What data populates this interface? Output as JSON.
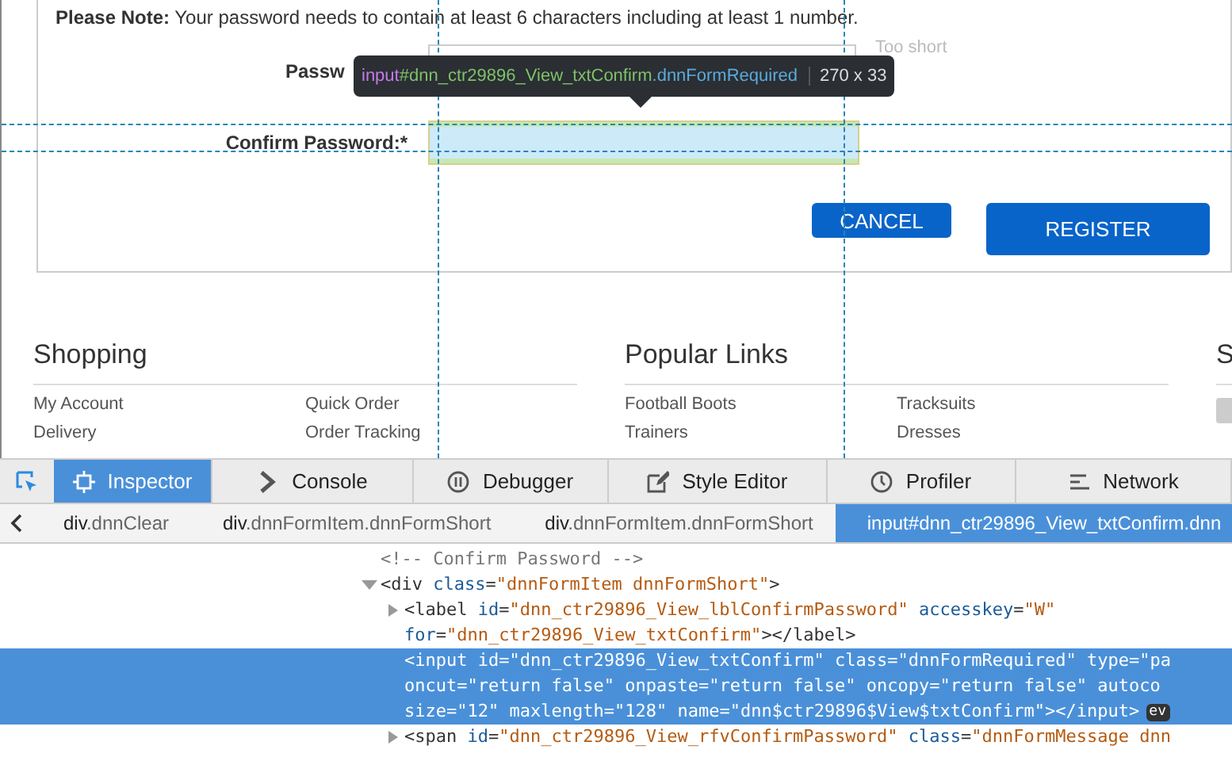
{
  "form": {
    "note_label": "Please Note:",
    "note_text": "Your password needs to contain at least 6 characters including at least 1 number.",
    "fields": [
      {
        "label": "Passw",
        "hint": "Too short",
        "highlighted": false
      },
      {
        "label": "Confirm Password:*",
        "highlighted": true
      }
    ],
    "buttons": [
      {
        "label": "CANCEL",
        "kind": "secondary"
      },
      {
        "label": "REGISTER",
        "kind": "primary"
      }
    ]
  },
  "tooltip": {
    "tag": "input",
    "id": "#dnn_ctr29896_View_txtConfirm",
    "class": ".dnnFormRequired",
    "size": "270 x 33"
  },
  "footer": [
    {
      "title": "Shopping",
      "links": [
        [
          "My Account",
          "Quick Order"
        ],
        [
          "Delivery",
          "Order Tracking"
        ]
      ]
    },
    {
      "title": "Popular Links",
      "links": [
        [
          "Football Boots",
          "Tracksuits"
        ],
        [
          "Trainers",
          "Dresses"
        ]
      ]
    },
    {
      "title": "S"
    }
  ],
  "devtools": {
    "tabs": [
      {
        "label": "Inspector",
        "selected": true
      },
      {
        "label": "Console",
        "selected": false
      },
      {
        "label": "Debugger",
        "selected": false
      },
      {
        "label": "Style Editor",
        "selected": false
      },
      {
        "label": "Profiler",
        "selected": false
      },
      {
        "label": "Network",
        "selected": false
      }
    ],
    "breadcrumbs": [
      {
        "tag": "div",
        "cls": ".dnnClear",
        "selected": false
      },
      {
        "tag": "div",
        "cls": ".dnnFormItem.dnnFormShort",
        "selected": false
      },
      {
        "tag": "div",
        "cls": ".dnnFormItem.dnnFormShort",
        "selected": false
      },
      {
        "tag": "input",
        "cls": "#dnn_ctr29896_View_txtConfirm.dnn",
        "selected": true
      }
    ],
    "tree": [
      {
        "kind": "comment",
        "selected": false,
        "lines": [
          "<!-- Confirm Password -->"
        ]
      },
      {
        "kind": "element",
        "expanded": true,
        "selected": false,
        "lines": [
          "<div class=\"dnnFormItem dnnFormShort\">"
        ],
        "children": [
          {
            "kind": "element",
            "expanded": false,
            "selected": false,
            "lines": [
              "<label id=\"dnn_ctr29896_View_lblConfirmPassword\" accesskey=\"W\"",
              "for=\"dnn_ctr29896_View_txtConfirm\"></label>"
            ]
          },
          {
            "kind": "leaf",
            "selected": true,
            "lines": [
              "<input id=\"dnn_ctr29896_View_txtConfirm\" class=\"dnnFormRequired\" type=\"pa",
              "oncut=\"return false\" onpaste=\"return false\" oncopy=\"return false\" autoco",
              "size=\"12\" maxlength=\"128\" name=\"dnn$ctr29896$View$txtConfirm\"></input>"
            ],
            "badge": "ev"
          },
          {
            "kind": "element",
            "expanded": false,
            "selected": false,
            "lines": [
              "<span id=\"dnn_ctr29896_View_rfvConfirmPassword\" class=\"dnnFormMessage dnn"
            ]
          }
        ]
      }
    ]
  }
}
